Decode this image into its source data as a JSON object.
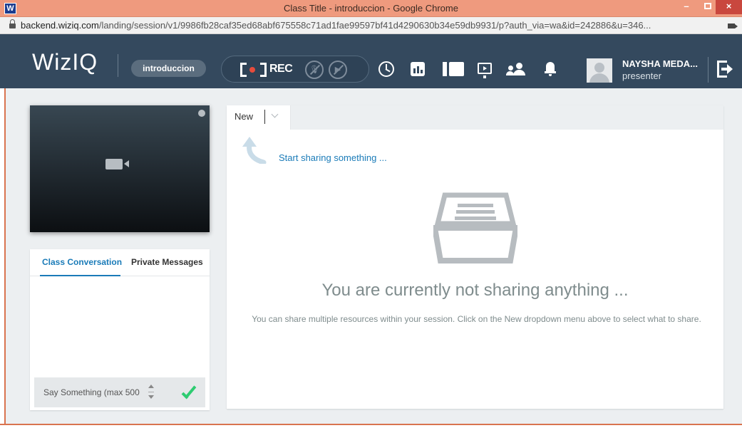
{
  "window": {
    "title": "Class Title - introduccion - Google Chrome",
    "app_icon": "W",
    "min_glyph": "–",
    "close_glyph": "×"
  },
  "address_bar": {
    "host": "backend.wiziq.com",
    "path": "/landing/session/v1/9986fb28caf35ed68abf675558c71ad1fae99597bf41d4290630b34e59db9931/p?auth_via=wa&id=242886&u=346..."
  },
  "toolbar": {
    "brand": "WizIQ",
    "session_name": "introduccion",
    "rec_label": "REC",
    "user": {
      "name": "NAYSHA MEDA...",
      "role": "presenter"
    }
  },
  "chat": {
    "tabs": [
      {
        "label": "Class Conversation",
        "active": true
      },
      {
        "label": "Private Messages",
        "active": false
      }
    ],
    "input_placeholder": "Say Something (max 500"
  },
  "share": {
    "tab_label": "New",
    "hint": "Start sharing something ...",
    "empty_title": "You are currently not sharing anything ...",
    "empty_description": "You can share multiple resources within your session. Click on the New dropdown menu above to select what to share."
  },
  "icons": {
    "accent": "#1a7bb8",
    "toolbar_bg": "#34495e",
    "rec_dot": "#e74c3c",
    "send": "#2ecc71"
  }
}
